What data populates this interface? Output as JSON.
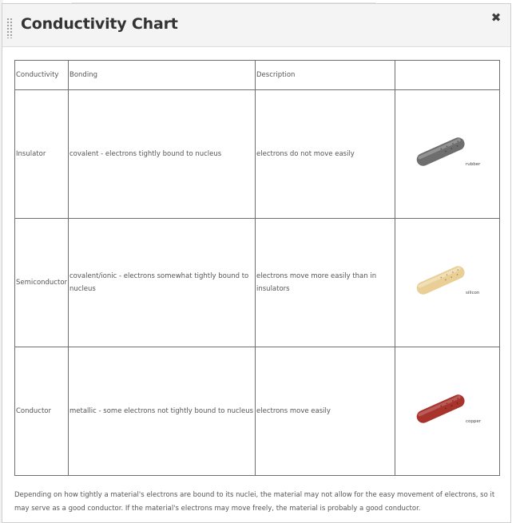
{
  "dialog": {
    "title": "Conductivity Chart",
    "close_label": "✖"
  },
  "table": {
    "headers": [
      "Conductivity",
      "Bonding",
      "Description",
      ""
    ],
    "rows": [
      {
        "conductivity": "Insulator",
        "bonding": "covalent - electrons tightly bound to nucleus",
        "description": "electrons do not move easily",
        "image_label": "rubber",
        "image_color": "#6e6e6e"
      },
      {
        "conductivity": "Semiconductor",
        "bonding": "covalent/ionic - electrons somewhat tightly bound to nucleus",
        "description": "electrons move more easily than in insulators",
        "image_label": "silicon",
        "image_color": "#e9cf96"
      },
      {
        "conductivity": "Conductor",
        "bonding": "metallic - some electrons not tightly bound to nucleus",
        "description": "electrons move easily",
        "image_label": "copper",
        "image_color": "#a8322c"
      }
    ]
  },
  "footer": {
    "text": "Depending on how tightly a material's electrons are bound to its nuclei, the material may not allow for the easy movement of electrons, so it may serve as a good conductor. If the material's electrons may move freely, the material is probably a good conductor."
  }
}
